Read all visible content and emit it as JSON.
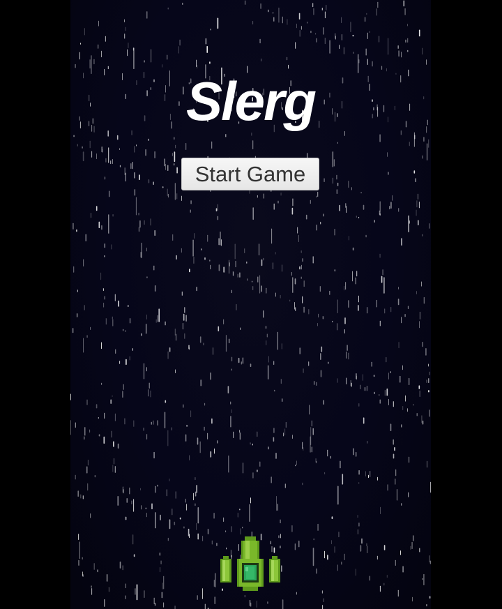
{
  "game": {
    "title": "Slerg",
    "start_button_label": "Start Game"
  },
  "icons": {
    "player_ship": "green-spaceship-icon"
  },
  "colors": {
    "background": "#05050f",
    "title_text": "#ffffff",
    "button_bg": "#eeeeee",
    "button_text": "#333333",
    "ship_body": "#7ab82a",
    "ship_cockpit": "#2aa65a"
  }
}
